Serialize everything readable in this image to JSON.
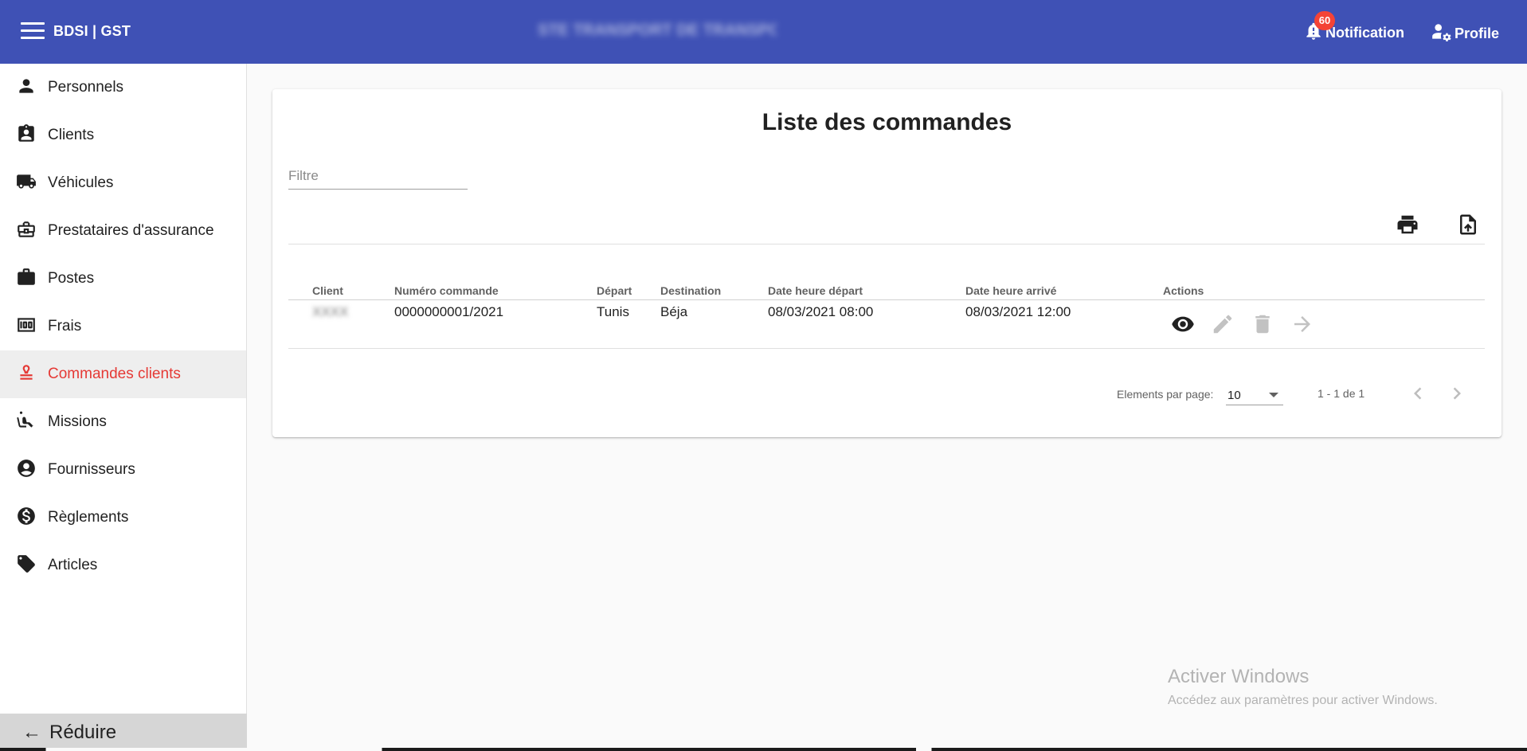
{
  "header": {
    "app_title": "BDSI | GST",
    "blurred_title": "STE TRANSPORT DE TRANSPORTS",
    "notification_count": "60",
    "notification_label": "Notification",
    "profile_label": "Profile"
  },
  "sidebar": {
    "items": [
      {
        "label": "Personnels",
        "icon": "person-icon"
      },
      {
        "label": "Clients",
        "icon": "contact-badge-icon"
      },
      {
        "label": "Véhicules",
        "icon": "truck-icon"
      },
      {
        "label": "Prestataires d'assurance",
        "icon": "business-center-icon"
      },
      {
        "label": "Postes",
        "icon": "work-icon"
      },
      {
        "label": "Frais",
        "icon": "money-icon"
      },
      {
        "label": "Commandes clients",
        "icon": "stamp-icon"
      },
      {
        "label": "Missions",
        "icon": "airline-seat-icon"
      },
      {
        "label": "Fournisseurs",
        "icon": "account-circle-icon"
      },
      {
        "label": "Règlements",
        "icon": "dollar-icon"
      },
      {
        "label": "Articles",
        "icon": "tag-icon"
      }
    ],
    "active_item": "Commandes clients",
    "reduce_label": "Réduire",
    "accent_color": "#e53935"
  },
  "main": {
    "title": "Liste des commandes",
    "filter_placeholder": "Filtre",
    "table": {
      "columns": [
        "Client",
        "Numéro commande",
        "Départ",
        "Destination",
        "Date heure départ",
        "Date heure arrivé",
        "Actions"
      ],
      "rows": [
        {
          "client": "XXXX",
          "numero": "0000000001/2021",
          "depart": "Tunis",
          "destination": "Béja",
          "date_depart": "08/03/2021 08:00",
          "date_arrive": "08/03/2021 12:00",
          "actions": [
            "visibility-icon",
            "edit-icon",
            "delete-icon",
            "arrow-forward-icon"
          ]
        }
      ]
    },
    "paginator": {
      "items_per_page_label": "Elements par page:",
      "page_size": "10",
      "range_label": "1 - 1 de 1"
    }
  },
  "watermark": {
    "title": "Activer Windows",
    "subtitle": "Accédez aux paramètres pour activer Windows."
  },
  "colors": {
    "topbar": "#3f51b5",
    "badge": "#f44336",
    "active": "#e53935"
  }
}
